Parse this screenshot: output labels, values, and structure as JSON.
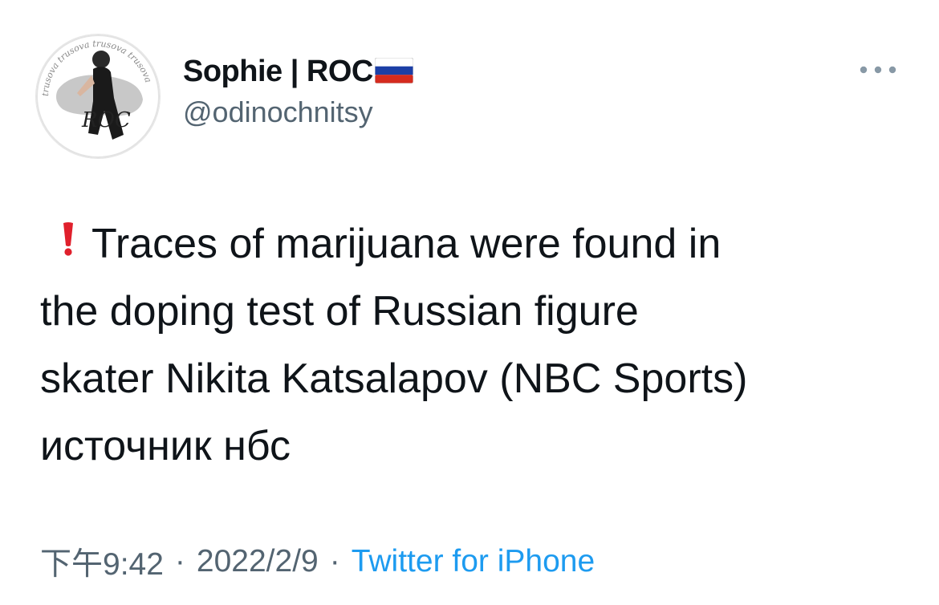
{
  "author": {
    "display_name": "Sophie | ROC",
    "handle": "@odinochnitsy",
    "flag_icon": "russia-flag-icon",
    "avatar_icon": "profile-avatar",
    "avatar_ring_text": "trusova trusova trusova trusova",
    "avatar_logo_text": "ROC"
  },
  "tweet": {
    "lines": [
      "Traces of marijuana were found in",
      "the doping test of Russian figure",
      "skater Nikita Katsalapov (NBC Sports)",
      "источник нбс"
    ],
    "lead_icon": "exclamation-mark-icon"
  },
  "meta": {
    "time": "下午9:42",
    "separator": "·",
    "date": "2022/2/9",
    "source": "Twitter for iPhone"
  },
  "colors": {
    "text": "#0f1419",
    "secondary": "#536471",
    "link": "#1d9bf0",
    "exclaim": "#e0202c"
  },
  "more_icon": "more-options-icon"
}
